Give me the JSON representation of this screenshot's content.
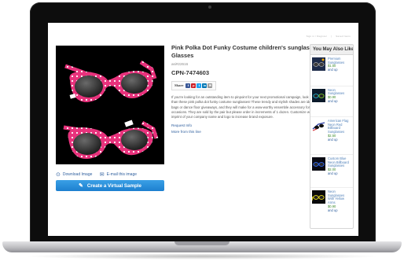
{
  "header_links": [
    "Sign in / Register",
    "Saved Items"
  ],
  "product": {
    "title": "Pink Polka Dot Funky Costume children's sunglasses Glasses",
    "sku": "asi#22616",
    "cpn": "CPN-7474603",
    "share_label": "Share",
    "share_icons": [
      {
        "icon": "facebook-icon",
        "glyph": "f",
        "color": "#3b5998"
      },
      {
        "icon": "pinterest-icon",
        "glyph": "p",
        "color": "#cb2027"
      },
      {
        "icon": "twitter-icon",
        "glyph": "t",
        "color": "#1da1f2"
      },
      {
        "icon": "linkedin-icon",
        "glyph": "in",
        "color": "#0077b5"
      },
      {
        "icon": "email-icon",
        "glyph": "✉",
        "color": "#9a9a9a"
      }
    ],
    "description": "If you're looking for an outstanding item to pinpoint for your next promotional campaign, look no further than these pink polka dot funky costume sunglasses! These trendy and stylish shades are ideal for root bags or dance floor giveaways, and they will make for a wow-worthy ensemble accessory for several occasions. They are sold by the pair but please order in increments of 1 dozen. Customize with an imprint of your company name and logo to increase brand exposure.",
    "request_info": "Request Info",
    "more_from_line": "More from this line",
    "download_image": "Download Image",
    "email_image": "E-mail this image",
    "virtual_sample": "Create a Virtual Sample"
  },
  "sidebar": {
    "heading": "You May Also Like...",
    "items": [
      {
        "name": "Premium Sunglasses",
        "price": "$1.50",
        "suffix": "and up"
      },
      {
        "name": "Neon Sunglasses",
        "price": "$0.90",
        "suffix": "and up"
      },
      {
        "name": "American Flag Neon Red Billboard Sunglasses",
        "price": "$2.50",
        "suffix": "and up"
      },
      {
        "name": "Custom Blue Neon Billboard Sunglasses",
        "price": "$2.00",
        "suffix": "and up"
      },
      {
        "name": "Neon Sunglasses With Yellow Arms",
        "price": "$0.90",
        "suffix": "and up"
      }
    ]
  },
  "colors": {
    "link": "#2f5f9e",
    "price": "#3d8a2c",
    "button": "#1d7fcf",
    "frame_pink": "#e8327c"
  }
}
